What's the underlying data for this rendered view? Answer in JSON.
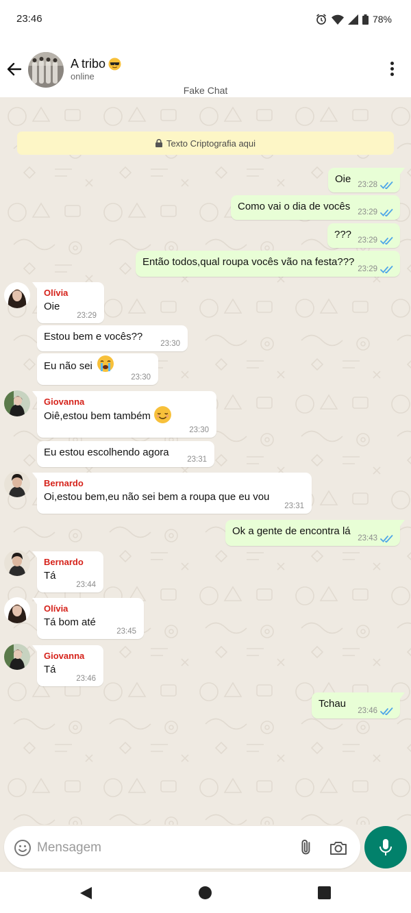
{
  "status_bar": {
    "time": "23:46",
    "battery": "78%"
  },
  "header": {
    "title": "A tribo",
    "title_emoji": "sunglasses-emoji",
    "subtitle": "online",
    "caption": "Fake Chat"
  },
  "banner": {
    "text": "Texto Criptografia aqui"
  },
  "messages": [
    {
      "dir": "out",
      "text": "Oie",
      "time": "23:28"
    },
    {
      "dir": "out",
      "text": "Como vai o dia de vocês",
      "time": "23:29"
    },
    {
      "dir": "out",
      "text": "???",
      "time": "23:29"
    },
    {
      "dir": "out",
      "text": "Então todos,qual roupa vocês vão na festa???",
      "time": "23:29"
    },
    {
      "dir": "in",
      "sender": "Olívia",
      "text": "Oie",
      "time": "23:29"
    },
    {
      "dir": "in",
      "text": "Estou bem e vocês??",
      "time": "23:30"
    },
    {
      "dir": "in",
      "text": "Eu não sei",
      "emoji": "crying-face-emoji",
      "time": "23:30"
    },
    {
      "dir": "in",
      "sender": "Giovanna",
      "text": "Oiê,estou bem também",
      "emoji": "smiling-face-emoji",
      "time": "23:30"
    },
    {
      "dir": "in",
      "text": "Eu estou escolhendo agora",
      "time": "23:31"
    },
    {
      "dir": "in",
      "sender": "Bernardo",
      "text": "Oi,estou bem,eu não sei bem a roupa que eu vou",
      "time": "23:31"
    },
    {
      "dir": "out",
      "text": "Ok a gente de encontra lá",
      "time": "23:43"
    },
    {
      "dir": "in",
      "sender": "Bernardo",
      "text": "Tá",
      "time": "23:44"
    },
    {
      "dir": "in",
      "sender": "Olívia",
      "text": "Tá bom até",
      "time": "23:45"
    },
    {
      "dir": "in",
      "sender": "Giovanna",
      "text": "Tá",
      "time": "23:46"
    },
    {
      "dir": "out",
      "text": "Tchau",
      "time": "23:46"
    }
  ],
  "composer": {
    "placeholder": "Mensagem"
  },
  "colors": {
    "header_bg": "#ffffff",
    "chat_bg": "#efeae2",
    "out_bubble": "#e8fed6",
    "in_bubble": "#ffffff",
    "sender_name": "#d5221a",
    "read_tick": "#4fa6e8",
    "mic_button": "#02816b",
    "banner_bg": "#fdf6c6"
  }
}
